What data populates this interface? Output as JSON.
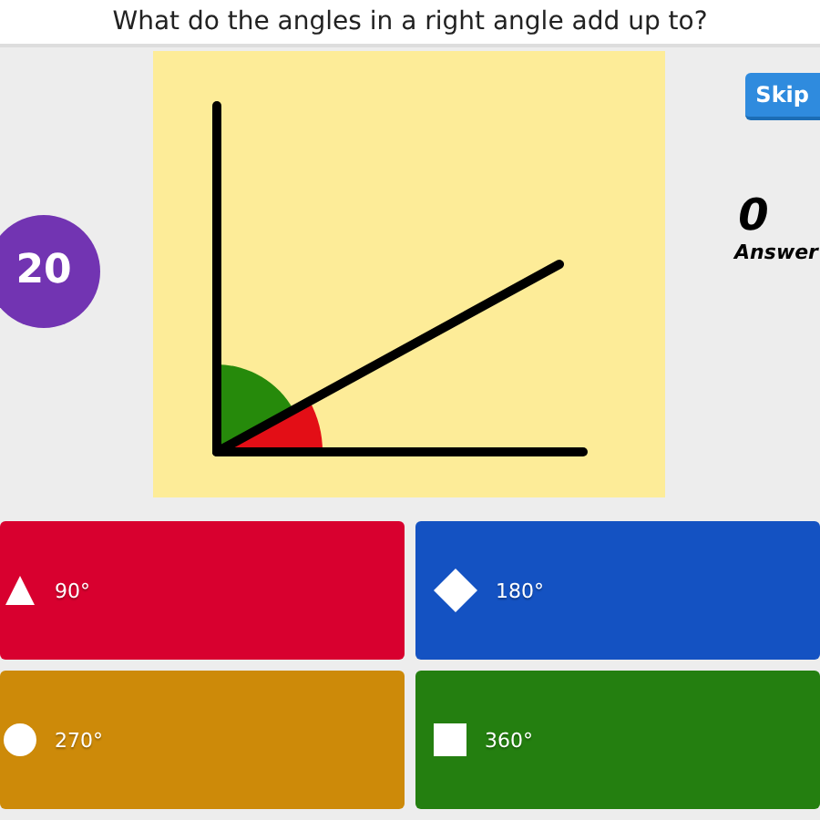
{
  "question": "What do the angles in a right angle add up to?",
  "timer": "20",
  "skip_button": "Skip",
  "answer_count": "0",
  "answer_count_label": "Answer",
  "answers": [
    {
      "label": "90°",
      "kind": "triangle",
      "color": "#d8002f"
    },
    {
      "label": "180°",
      "kind": "diamond",
      "color": "#1452c2"
    },
    {
      "label": "270°",
      "kind": "circle",
      "color": "#cd8a09"
    },
    {
      "label": "360°",
      "kind": "square",
      "color": "#247f10"
    }
  ]
}
